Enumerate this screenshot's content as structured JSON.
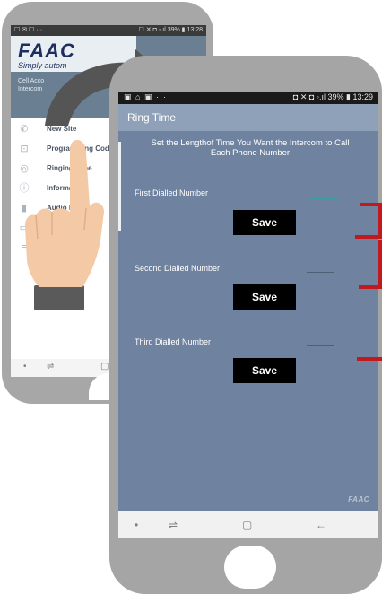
{
  "back_phone": {
    "status_left": "☐ ✉ ☐ ···",
    "status_right": "☐ ✕ ◘ ◦.ıl 39% ▮ 13:28",
    "logo": "FAAC",
    "tagline": "Simply autom",
    "account_line1": "Cell Acco",
    "account_line2": "Intercom",
    "menu": [
      {
        "icon": "phone-icon",
        "glyph": "✆",
        "label": "New Site"
      },
      {
        "icon": "lock-icon",
        "glyph": "⊡",
        "label": "Programming Codes"
      },
      {
        "icon": "ring-icon",
        "glyph": "◎",
        "label": "Ringing Time"
      },
      {
        "icon": "info-icon",
        "glyph": "ⓘ",
        "label": "Informati"
      },
      {
        "icon": "chart-icon",
        "glyph": "▮",
        "label": "Audio Le"
      },
      {
        "icon": "printer-icon",
        "glyph": "▭",
        "label": ""
      },
      {
        "icon": "list-icon",
        "glyph": "≡",
        "label": ""
      }
    ],
    "nav_left": "•",
    "nav_center": "⇌",
    "nav_right": "▢"
  },
  "front_phone": {
    "status_left": "▣ ⌂ ▣ ···",
    "status_right": "◘ ✕ ◘ ◦.ıl 39% ▮ 13:29",
    "title": "Ring Time",
    "instructions_line1": "Set the Lengthof Time You Want the Intercom to Call",
    "instructions_line2": "Each Phone Number",
    "fields": [
      {
        "label": "First Dialled Number",
        "value": "",
        "save_label": "Save"
      },
      {
        "label": "Second Dialled Number",
        "value": "",
        "save_label": "Save"
      },
      {
        "label": "Third Dialled Number",
        "value": "",
        "save_label": "Save"
      }
    ],
    "watermark": "FAAC",
    "nav_dot": "•",
    "nav_recents": "⇌",
    "nav_home": "▢",
    "nav_back": "←"
  },
  "colors": {
    "screen_bg": "#6f83a0",
    "app_bar": "#8fa1b8",
    "phone_frame": "#a5a5a5",
    "annotation": "#c0191f"
  }
}
